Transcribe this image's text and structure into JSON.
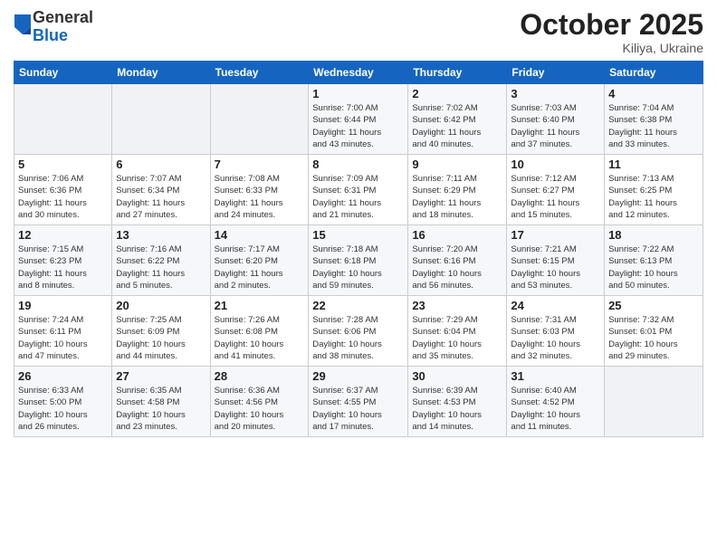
{
  "header": {
    "logo_general": "General",
    "logo_blue": "Blue",
    "month_title": "October 2025",
    "location": "Kiliya, Ukraine"
  },
  "days_of_week": [
    "Sunday",
    "Monday",
    "Tuesday",
    "Wednesday",
    "Thursday",
    "Friday",
    "Saturday"
  ],
  "weeks": [
    [
      {
        "day": "",
        "info": ""
      },
      {
        "day": "",
        "info": ""
      },
      {
        "day": "",
        "info": ""
      },
      {
        "day": "1",
        "info": "Sunrise: 7:00 AM\nSunset: 6:44 PM\nDaylight: 11 hours\nand 43 minutes."
      },
      {
        "day": "2",
        "info": "Sunrise: 7:02 AM\nSunset: 6:42 PM\nDaylight: 11 hours\nand 40 minutes."
      },
      {
        "day": "3",
        "info": "Sunrise: 7:03 AM\nSunset: 6:40 PM\nDaylight: 11 hours\nand 37 minutes."
      },
      {
        "day": "4",
        "info": "Sunrise: 7:04 AM\nSunset: 6:38 PM\nDaylight: 11 hours\nand 33 minutes."
      }
    ],
    [
      {
        "day": "5",
        "info": "Sunrise: 7:06 AM\nSunset: 6:36 PM\nDaylight: 11 hours\nand 30 minutes."
      },
      {
        "day": "6",
        "info": "Sunrise: 7:07 AM\nSunset: 6:34 PM\nDaylight: 11 hours\nand 27 minutes."
      },
      {
        "day": "7",
        "info": "Sunrise: 7:08 AM\nSunset: 6:33 PM\nDaylight: 11 hours\nand 24 minutes."
      },
      {
        "day": "8",
        "info": "Sunrise: 7:09 AM\nSunset: 6:31 PM\nDaylight: 11 hours\nand 21 minutes."
      },
      {
        "day": "9",
        "info": "Sunrise: 7:11 AM\nSunset: 6:29 PM\nDaylight: 11 hours\nand 18 minutes."
      },
      {
        "day": "10",
        "info": "Sunrise: 7:12 AM\nSunset: 6:27 PM\nDaylight: 11 hours\nand 15 minutes."
      },
      {
        "day": "11",
        "info": "Sunrise: 7:13 AM\nSunset: 6:25 PM\nDaylight: 11 hours\nand 12 minutes."
      }
    ],
    [
      {
        "day": "12",
        "info": "Sunrise: 7:15 AM\nSunset: 6:23 PM\nDaylight: 11 hours\nand 8 minutes."
      },
      {
        "day": "13",
        "info": "Sunrise: 7:16 AM\nSunset: 6:22 PM\nDaylight: 11 hours\nand 5 minutes."
      },
      {
        "day": "14",
        "info": "Sunrise: 7:17 AM\nSunset: 6:20 PM\nDaylight: 11 hours\nand 2 minutes."
      },
      {
        "day": "15",
        "info": "Sunrise: 7:18 AM\nSunset: 6:18 PM\nDaylight: 10 hours\nand 59 minutes."
      },
      {
        "day": "16",
        "info": "Sunrise: 7:20 AM\nSunset: 6:16 PM\nDaylight: 10 hours\nand 56 minutes."
      },
      {
        "day": "17",
        "info": "Sunrise: 7:21 AM\nSunset: 6:15 PM\nDaylight: 10 hours\nand 53 minutes."
      },
      {
        "day": "18",
        "info": "Sunrise: 7:22 AM\nSunset: 6:13 PM\nDaylight: 10 hours\nand 50 minutes."
      }
    ],
    [
      {
        "day": "19",
        "info": "Sunrise: 7:24 AM\nSunset: 6:11 PM\nDaylight: 10 hours\nand 47 minutes."
      },
      {
        "day": "20",
        "info": "Sunrise: 7:25 AM\nSunset: 6:09 PM\nDaylight: 10 hours\nand 44 minutes."
      },
      {
        "day": "21",
        "info": "Sunrise: 7:26 AM\nSunset: 6:08 PM\nDaylight: 10 hours\nand 41 minutes."
      },
      {
        "day": "22",
        "info": "Sunrise: 7:28 AM\nSunset: 6:06 PM\nDaylight: 10 hours\nand 38 minutes."
      },
      {
        "day": "23",
        "info": "Sunrise: 7:29 AM\nSunset: 6:04 PM\nDaylight: 10 hours\nand 35 minutes."
      },
      {
        "day": "24",
        "info": "Sunrise: 7:31 AM\nSunset: 6:03 PM\nDaylight: 10 hours\nand 32 minutes."
      },
      {
        "day": "25",
        "info": "Sunrise: 7:32 AM\nSunset: 6:01 PM\nDaylight: 10 hours\nand 29 minutes."
      }
    ],
    [
      {
        "day": "26",
        "info": "Sunrise: 6:33 AM\nSunset: 5:00 PM\nDaylight: 10 hours\nand 26 minutes."
      },
      {
        "day": "27",
        "info": "Sunrise: 6:35 AM\nSunset: 4:58 PM\nDaylight: 10 hours\nand 23 minutes."
      },
      {
        "day": "28",
        "info": "Sunrise: 6:36 AM\nSunset: 4:56 PM\nDaylight: 10 hours\nand 20 minutes."
      },
      {
        "day": "29",
        "info": "Sunrise: 6:37 AM\nSunset: 4:55 PM\nDaylight: 10 hours\nand 17 minutes."
      },
      {
        "day": "30",
        "info": "Sunrise: 6:39 AM\nSunset: 4:53 PM\nDaylight: 10 hours\nand 14 minutes."
      },
      {
        "day": "31",
        "info": "Sunrise: 6:40 AM\nSunset: 4:52 PM\nDaylight: 10 hours\nand 11 minutes."
      },
      {
        "day": "",
        "info": ""
      }
    ]
  ]
}
